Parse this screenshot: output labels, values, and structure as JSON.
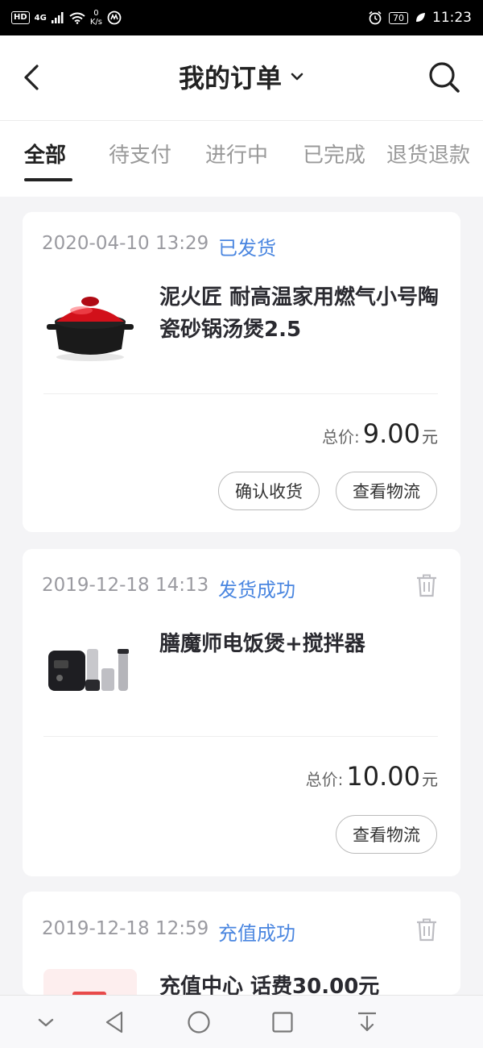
{
  "status_bar": {
    "hd": "HD",
    "network": "4G",
    "speed_value": "0",
    "speed_unit": "K/s",
    "battery": "70",
    "time": "11:23"
  },
  "header": {
    "title": "我的订单"
  },
  "tabs": [
    {
      "label": "全部",
      "active": true
    },
    {
      "label": "待支付",
      "active": false
    },
    {
      "label": "进行中",
      "active": false
    },
    {
      "label": "已完成",
      "active": false
    },
    {
      "label": "退货退款",
      "active": false
    }
  ],
  "orders": [
    {
      "date": "2020-04-10 13:29",
      "status": "已发货",
      "product_title": "泥火匠 耐高温家用燃气小号陶瓷砂锅汤煲2.5",
      "price_label": "总价:",
      "price": "9.00",
      "price_unit": "元",
      "buttons": [
        "确认收货",
        "查看物流"
      ]
    },
    {
      "date": "2019-12-18 14:13",
      "status": "发货成功",
      "product_title": "膳魔师电饭煲+搅拌器",
      "price_label": "总价:",
      "price": "10.00",
      "price_unit": "元",
      "buttons": [
        "查看物流"
      ]
    },
    {
      "date": "2019-12-18 12:59",
      "status": "充值成功",
      "product_title": "充值中心 话费30.00元"
    }
  ],
  "colors": {
    "status_blue": "#4a86e0",
    "page_bg": "#f4f4f6"
  }
}
